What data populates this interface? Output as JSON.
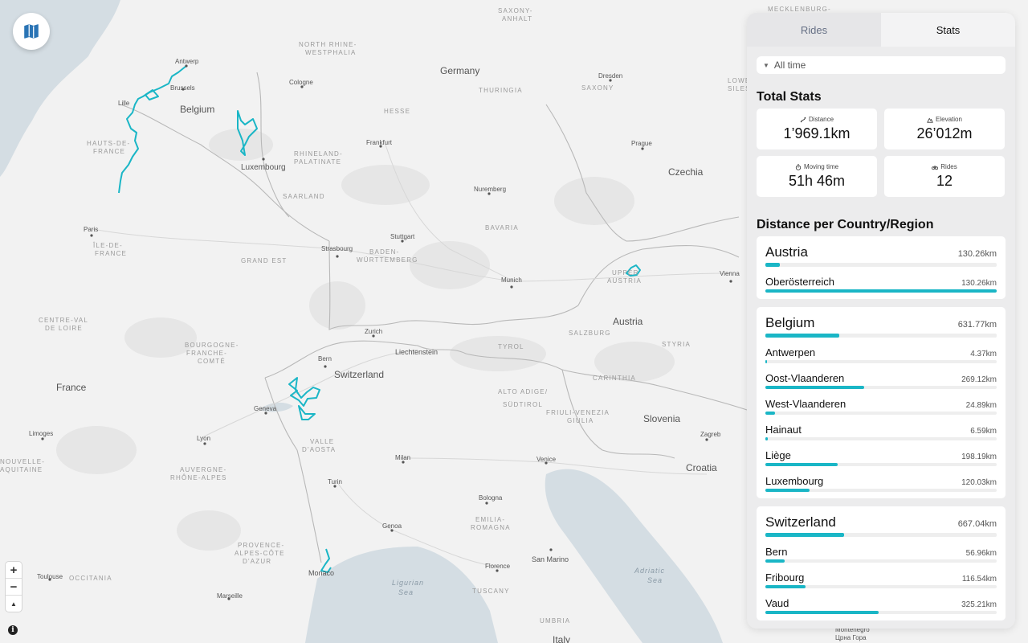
{
  "map": {
    "countries": [
      "Germany",
      "Belgium",
      "Czechia",
      "Austria",
      "Switzerland",
      "France",
      "Slovenia",
      "Croatia",
      "Liechtenstein",
      "Italy",
      "Luxembourg"
    ],
    "cities": [
      "Antwerp",
      "Brussels",
      "Lille",
      "Cologne",
      "Dresden",
      "Frankfurt",
      "Prague",
      "Luxembourg",
      "Nuremberg",
      "Paris",
      "Stuttgart",
      "Strasbourg",
      "Munich",
      "Vienna",
      "Zurich",
      "Bern",
      "Geneva",
      "Lyon",
      "Limoges",
      "Milan",
      "Turin",
      "Venice",
      "Zagreb",
      "Genoa",
      "Bologna",
      "San Marino",
      "Florence",
      "Monaco",
      "Marseille",
      "Toulouse"
    ],
    "regions": [
      "SAXONY-ANHALT",
      "NORTH RHINE-WESTPHALIA",
      "HESSE",
      "THURINGIA",
      "SAXONY",
      "LOWER SILESIA",
      "RHINELAND-PALATINATE",
      "SAARLAND",
      "HAUTS-DE-FRANCE",
      "BAVARIA",
      "BADEN-WÜRTTEMBERG",
      "GRAND EST",
      "ÎLE-DE-FRANCE",
      "CENTRE-VAL DE LOIRE",
      "BOURGOGNE-FRANCHE-COMTÉ",
      "UPPER AUSTRIA",
      "SALZBURG",
      "TYROL",
      "STYRIA",
      "CARINTHIA",
      "VALLE D'AOSTA",
      "TRENTINO-ALTO ADIGE/SÜDTIROL",
      "FRIULI-VENEZIA GIULIA",
      "AUVERGNE-RHÔNE-ALPES",
      "NOUVELLE-AQUITAINE",
      "PROVENCE-ALPES-CÔTE D'AZUR",
      "OCCITANIA",
      "EMILIA-ROMAGNA",
      "TUSCANY",
      "UMBRIA",
      "MECKLENBURG-VORPOMMERN"
    ],
    "seas": [
      "Ligurian Sea",
      "Adriatic Sea"
    ],
    "bottom_city": "Italy",
    "footer_text": "Montenegro\nЦрна Гора",
    "route_color": "#1ab6c6",
    "water_color": "#d4dde3",
    "land_color": "#f2f2f2"
  },
  "controls": {
    "map_toggle_icon": "map-icon",
    "zoom_in": "+",
    "zoom_out": "−",
    "compass": "▲",
    "attribution": "i"
  },
  "panel": {
    "tabs": [
      {
        "label": "Rides",
        "active": false
      },
      {
        "label": "Stats",
        "active": true
      }
    ],
    "time_filter": "All time",
    "total_stats_title": "Total Stats",
    "stats": [
      {
        "icon": "route-icon",
        "label": "Distance",
        "value": "1’969.1km"
      },
      {
        "icon": "mountain-icon",
        "label": "Elevation",
        "value": "26’012m"
      },
      {
        "icon": "stopwatch-icon",
        "label": "Moving time",
        "value": "51h 46m"
      },
      {
        "icon": "bike-icon",
        "label": "Rides",
        "value": "12"
      }
    ],
    "distance_title": "Distance per Country/Region",
    "countries": [
      {
        "name": "Austria",
        "km": "130.26km",
        "fraction": 0.063,
        "regions": [
          {
            "name": "Oberösterreich",
            "km": "130.26km",
            "fraction": 1.0
          }
        ]
      },
      {
        "name": "Belgium",
        "km": "631.77km",
        "fraction": 0.32,
        "regions": [
          {
            "name": "Antwerpen",
            "km": "4.37km",
            "fraction": 0.007
          },
          {
            "name": "Oost-Vlaanderen",
            "km": "269.12km",
            "fraction": 0.426
          },
          {
            "name": "West-Vlaanderen",
            "km": "24.89km",
            "fraction": 0.04
          },
          {
            "name": "Hainaut",
            "km": "6.59km",
            "fraction": 0.01
          },
          {
            "name": "Liège",
            "km": "198.19km",
            "fraction": 0.314
          },
          {
            "name": "Luxembourg",
            "km": "120.03km",
            "fraction": 0.19
          }
        ]
      },
      {
        "name": "Switzerland",
        "km": "667.04km",
        "fraction": 0.339,
        "regions": [
          {
            "name": "Bern",
            "km": "56.96km",
            "fraction": 0.085
          },
          {
            "name": "Fribourg",
            "km": "116.54km",
            "fraction": 0.175
          },
          {
            "name": "Vaud",
            "km": "325.21km",
            "fraction": 0.488
          }
        ]
      }
    ]
  }
}
